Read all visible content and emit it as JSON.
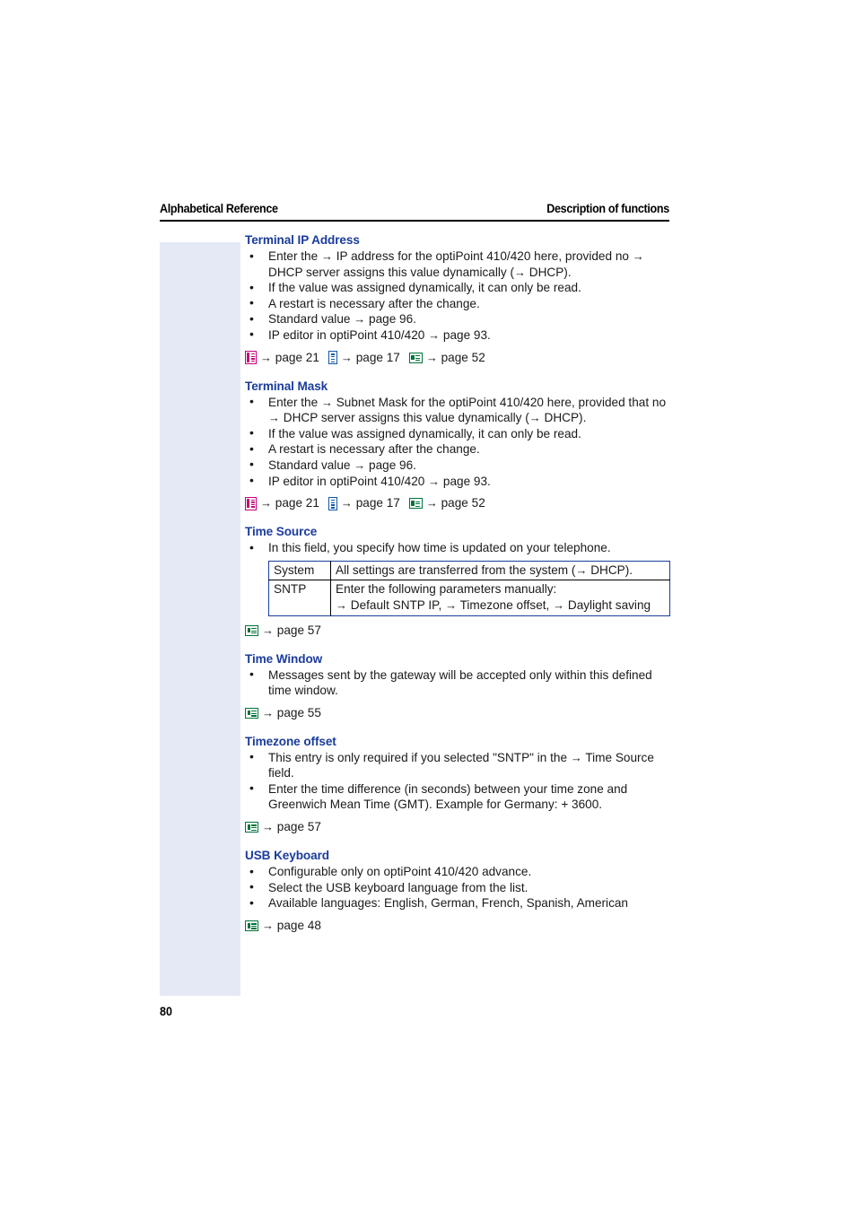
{
  "header": {
    "left": "Alphabetical Reference",
    "right": "Description of functions"
  },
  "folio": "80",
  "arrow": "→",
  "sections": [
    {
      "id": "terminal-ip-address",
      "title": "Terminal IP Address",
      "bullets": [
        "Enter the → IP address for the optiPoint 410/420 here, provided no → DHCP server assigns this value dynamically (→ DHCP).",
        "If the value was assigned dynamically, it can only be read.",
        "A restart is necessary after the change.",
        "Standard value → page 96.",
        "IP editor in optiPoint 410/420 → page 93."
      ],
      "refs": [
        {
          "icon": "manual-book-icon",
          "label": "→ page 21"
        },
        {
          "icon": "document-icon",
          "label": "→ page 17"
        },
        {
          "icon": "web-page-icon",
          "label": "→ page 52"
        }
      ]
    },
    {
      "id": "terminal-mask",
      "title": "Terminal Mask",
      "bullets": [
        "Enter the → Subnet Mask for the optiPoint 410/420 here, provided that no → DHCP server assigns this value dynamically (→ DHCP).",
        "If the value was assigned dynamically, it can only be read.",
        "A restart is necessary after the change.",
        "Standard value → page 96.",
        "IP editor in optiPoint 410/420 → page 93."
      ],
      "refs": [
        {
          "icon": "manual-book-icon",
          "label": "→ page 21"
        },
        {
          "icon": "document-icon",
          "label": "→ page 17"
        },
        {
          "icon": "web-page-icon",
          "label": "→ page 52"
        }
      ]
    },
    {
      "id": "time-source",
      "title": "Time Source",
      "bullets": [
        "In this field, you specify how time is updated on your telephone."
      ],
      "table": {
        "rows": [
          {
            "key": "System",
            "value": "All settings are transferred from the system (→ DHCP)."
          },
          {
            "key": "SNTP",
            "value": "Enter the following parameters manually:\n→ Default SNTP IP, → Timezone offset, → Daylight saving"
          }
        ]
      },
      "refs": [
        {
          "icon": "web-page-icon",
          "label": "→ page 57"
        }
      ]
    },
    {
      "id": "time-window",
      "title": "Time Window",
      "bullets": [
        "Messages sent by the gateway will be accepted only within this defined time window."
      ],
      "refs": [
        {
          "icon": "web-page-icon",
          "label": "→ page 55"
        }
      ]
    },
    {
      "id": "timezone-offset",
      "title": "Timezone offset",
      "bullets": [
        "This entry is only required if you selected \"SNTP\" in the → Time Source field.",
        "Enter the time difference (in seconds) between your time zone and Greenwich Mean Time (GMT). Example for Germany: + 3600."
      ],
      "refs": [
        {
          "icon": "web-page-icon",
          "label": "→ page 57"
        }
      ]
    },
    {
      "id": "usb-keyboard",
      "title": "USB Keyboard",
      "bullets": [
        "Configurable only on optiPoint 410/420 advance.",
        "Select the USB keyboard language from the list.",
        "Available languages: English, German, French, Spanish, American"
      ],
      "refs": [
        {
          "icon": "web-page-icon",
          "label": "→ page 48"
        }
      ]
    }
  ],
  "colors": {
    "heading": "#1a3c9c",
    "margin_block": "#e4e9f5",
    "table_border": "#1a3c9c",
    "icon_manual": "#c5007c",
    "icon_document": "#1257a8",
    "icon_web": "#00743a"
  }
}
